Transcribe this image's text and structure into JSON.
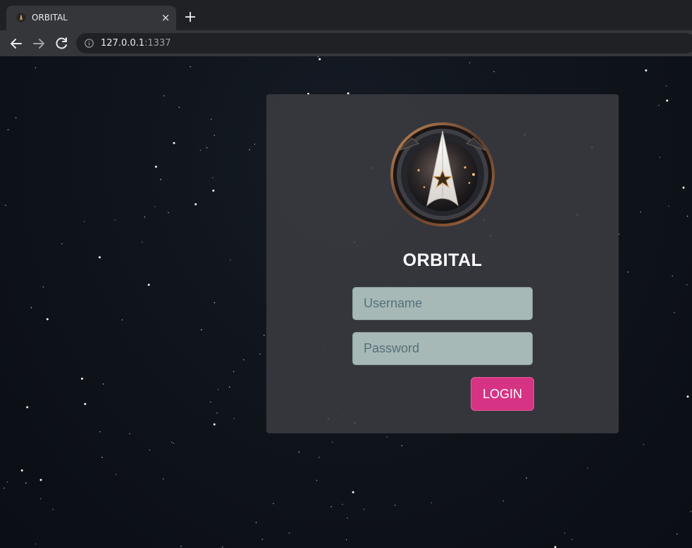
{
  "browser": {
    "tab_title": "ORBITAL",
    "tab_close": "×",
    "new_tab": "+",
    "url_host": "127.0.0.1",
    "url_port": ":1337"
  },
  "login": {
    "title": "ORBITAL",
    "username_placeholder": "Username",
    "password_placeholder": "Password",
    "login_label": "LOGIN"
  },
  "colors": {
    "background": "#0f131a",
    "card": "#383a3f",
    "input": "#a7b9b6",
    "accent": "#d63384"
  },
  "icons": {
    "back": "arrow-left-icon",
    "forward": "arrow-right-icon",
    "reload": "reload-icon",
    "info": "info-icon",
    "logo": "orbital-emblem-logo"
  }
}
